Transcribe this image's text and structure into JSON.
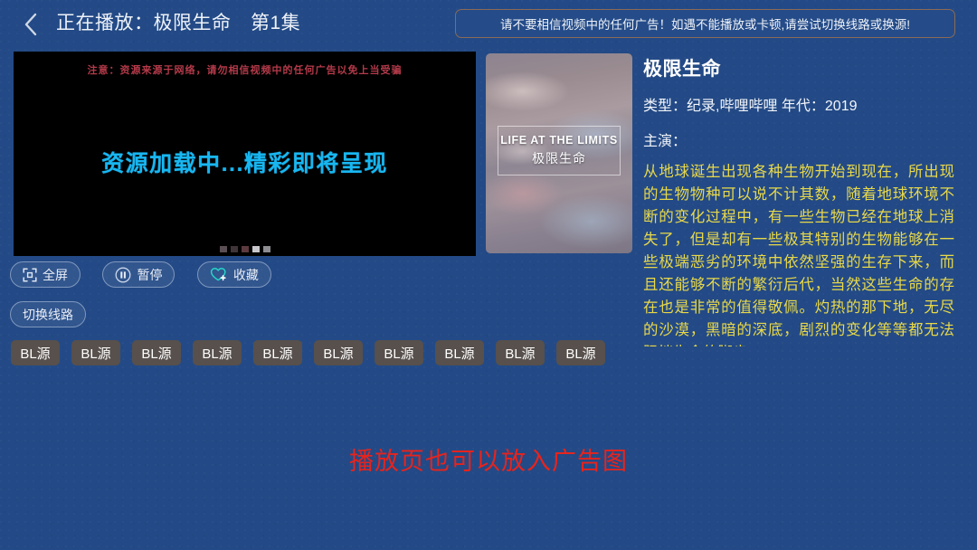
{
  "header": {
    "back_icon": "chevron-left-icon",
    "title": "正在播放：极限生命　第1集",
    "warning": "请不要相信视频中的任何广告！如遇不能播放或卡顿,请尝试切换线路或换源!"
  },
  "player": {
    "notice": "注意：资源来源于网络，请勿相信视频中的任何广告以免上当受骗",
    "loading": "资源加载中...精彩即将呈现",
    "notice_color": "#b53a4a",
    "loading_color": "#18b6f0",
    "background": "#000000"
  },
  "controls": [
    {
      "label": "全屏",
      "icon": "fullscreen-icon",
      "name": "fullscreen-button"
    },
    {
      "label": "暂停",
      "icon": "pause-icon",
      "name": "pause-button"
    },
    {
      "label": "收藏",
      "icon": "heart-plus-icon",
      "name": "favorite-button"
    }
  ],
  "route": {
    "label": "切换线路"
  },
  "sources": {
    "items": [
      {
        "label": "BL源"
      },
      {
        "label": "BL源"
      },
      {
        "label": "BL源"
      },
      {
        "label": "BL源"
      },
      {
        "label": "BL源"
      },
      {
        "label": "BL源"
      },
      {
        "label": "BL源"
      },
      {
        "label": "BL源"
      },
      {
        "label": "BL源"
      },
      {
        "label": "BL源"
      }
    ],
    "tag_color": "#57504c"
  },
  "poster": {
    "title_en": "LIFE AT THE LIMITS",
    "title_cn": "极限生命"
  },
  "info": {
    "title": "极限生命",
    "meta": "类型：纪录,哔哩哔哩  年代：2019",
    "cast": "主演：",
    "description": "从地球诞生出现各种生物开始到现在，所出现的生物物种可以说不计其数，随着地球环境不断的变化过程中，有一些生物已经在地球上消失了，但是却有一些极其特别的生物能够在一些极端恶劣的环境中依然坚强的生存下来，而且还能够不断的繁衍后代，当然这些生命的存在也是非常的值得敬佩。灼热的那下地，无尽的沙漠，黑暗的深底，剧烈的变化等等都无法阻挡生命的脚步。",
    "description_color": "#e8d84a"
  },
  "ad": {
    "text": "播放页也可以放入广告图",
    "color": "#e8231c"
  },
  "theme": {
    "background": "#234a86",
    "accent": "#18b6f0"
  }
}
